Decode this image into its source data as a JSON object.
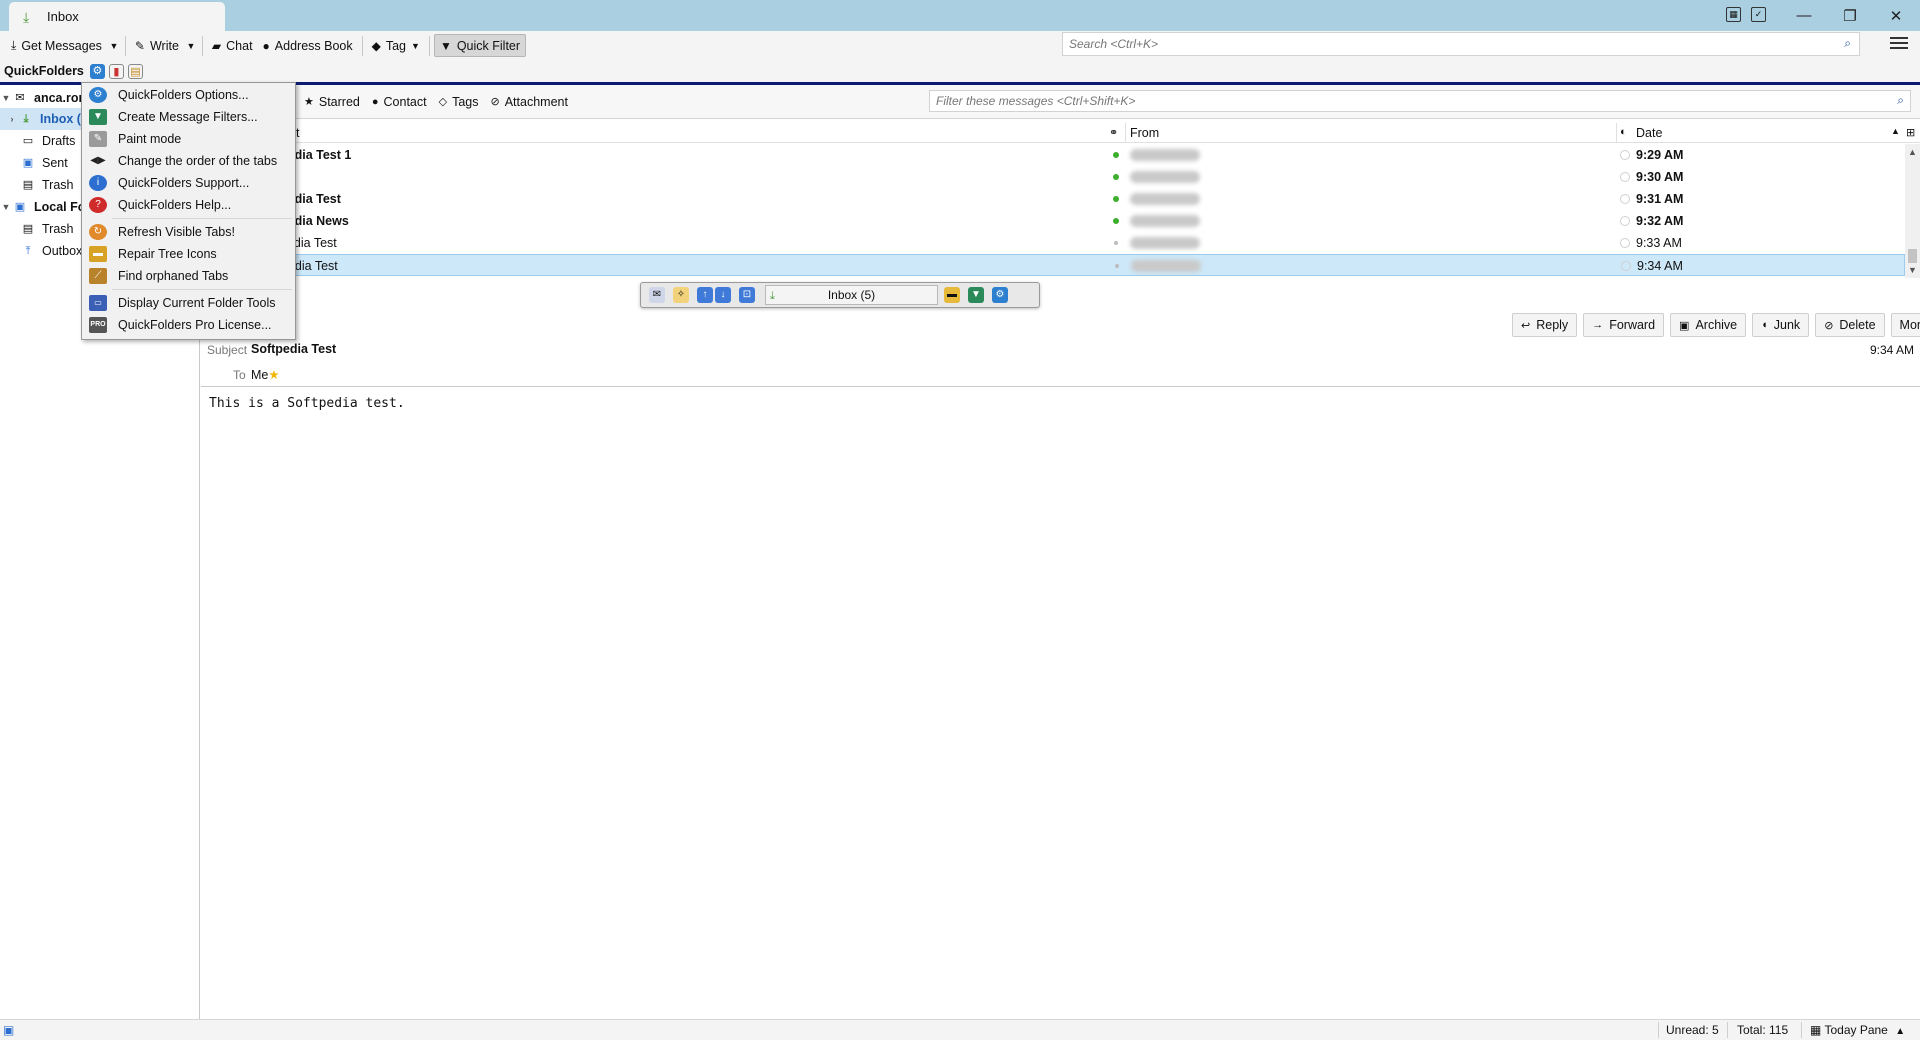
{
  "window": {
    "tab_title": "Inbox"
  },
  "toolbar": {
    "get_messages": "Get Messages",
    "write": "Write",
    "chat": "Chat",
    "address_book": "Address Book",
    "tag": "Tag",
    "quick_filter": "Quick Filter",
    "search_placeholder": "Search <Ctrl+K>"
  },
  "quickfolders": {
    "label": "QuickFolders"
  },
  "folders": [
    {
      "label": "anca.rom"
    },
    {
      "label": "Inbox ("
    },
    {
      "label": "Drafts"
    },
    {
      "label": "Sent"
    },
    {
      "label": "Trash"
    },
    {
      "label": "Local Fol"
    },
    {
      "label": "Trash"
    },
    {
      "label": "Outbox"
    }
  ],
  "quick_filter_bar": {
    "starred": "Starred",
    "contact": "Contact",
    "tags": "Tags",
    "attachment": "Attachment",
    "filter_placeholder": "Filter these messages <Ctrl+Shift+K>"
  },
  "thread_columns": {
    "subject": "ject",
    "from": "From",
    "date": "Date"
  },
  "messages": [
    {
      "subject": "pedia Test 1",
      "date": "9:29 AM",
      "unread": true
    },
    {
      "subject": "",
      "date": "9:30 AM",
      "unread": true
    },
    {
      "subject": "pedia Test",
      "date": "9:31 AM",
      "unread": true
    },
    {
      "subject": "pedia News",
      "date": "9:32 AM",
      "unread": true
    },
    {
      "subject": "pedia Test",
      "date": "9:33 AM",
      "unread": false
    },
    {
      "subject": "pedia Test",
      "date": "9:34 AM",
      "unread": false,
      "selected": true
    }
  ],
  "navbar": {
    "current_folder": "Inbox (5)"
  },
  "message_actions": {
    "reply": "Reply",
    "forward": "Forward",
    "archive": "Archive",
    "junk": "Junk",
    "delete": "Delete",
    "more": "More"
  },
  "message": {
    "subject_label": "Subject",
    "subject": "Softpedia Test",
    "time": "9:34 AM",
    "to_label": "To",
    "to": "Me",
    "body": "This is a Softpedia test."
  },
  "menu": {
    "items": [
      {
        "label": "QuickFolders Options...",
        "icon": "gear-icon",
        "color": "#2d7fd0"
      },
      {
        "label": "Create Message Filters...",
        "icon": "filter-icon",
        "color": "#2b8a5a"
      },
      {
        "label": "Paint mode",
        "icon": "paint-icon",
        "color": "#8a8a8a"
      },
      {
        "label": "Change the order of the tabs",
        "icon": "arrows-icon",
        "color": "#222222"
      },
      {
        "label": "QuickFolders Support...",
        "icon": "info-icon",
        "color": "#2d6fd0"
      },
      {
        "label": "QuickFolders Help...",
        "icon": "help-icon",
        "color": "#d02b2b"
      },
      {
        "label": "Refresh Visible Tabs!",
        "icon": "refresh-icon",
        "color": "#e08a2b"
      },
      {
        "label": "Repair Tree Icons",
        "icon": "folder-icon",
        "color": "#d8a227"
      },
      {
        "label": "Find orphaned Tabs",
        "icon": "broom-icon",
        "color": "#b8832b"
      },
      {
        "label": "Display Current Folder Tools",
        "icon": "tools-icon",
        "color": "#3b5fb5"
      },
      {
        "label": "QuickFolders Pro License...",
        "icon": "pro-icon",
        "color": "#555555"
      }
    ]
  },
  "status": {
    "unread": "Unread: 5",
    "total": "Total: 115",
    "today_pane": "Today Pane"
  }
}
